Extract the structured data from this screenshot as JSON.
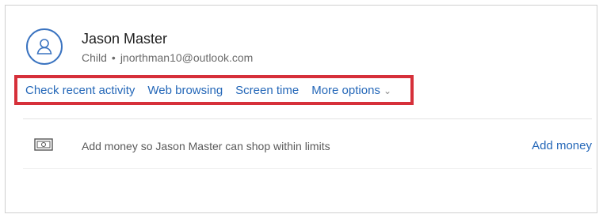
{
  "profile": {
    "name": "Jason Master",
    "role": "Child",
    "separator": "•",
    "email": "jnorthman10@outlook.com"
  },
  "actions": {
    "check_recent_activity": "Check recent activity",
    "web_browsing": "Web browsing",
    "screen_time": "Screen time",
    "more_options": "More options"
  },
  "money": {
    "message": "Add money so Jason Master can shop within limits",
    "add_money_label": "Add money"
  },
  "colors": {
    "accent": "#2467b8",
    "highlight_border": "#d6303a"
  },
  "icons": {
    "avatar": "person-icon",
    "more_options": "chevron-down-icon",
    "money": "money-icon"
  }
}
